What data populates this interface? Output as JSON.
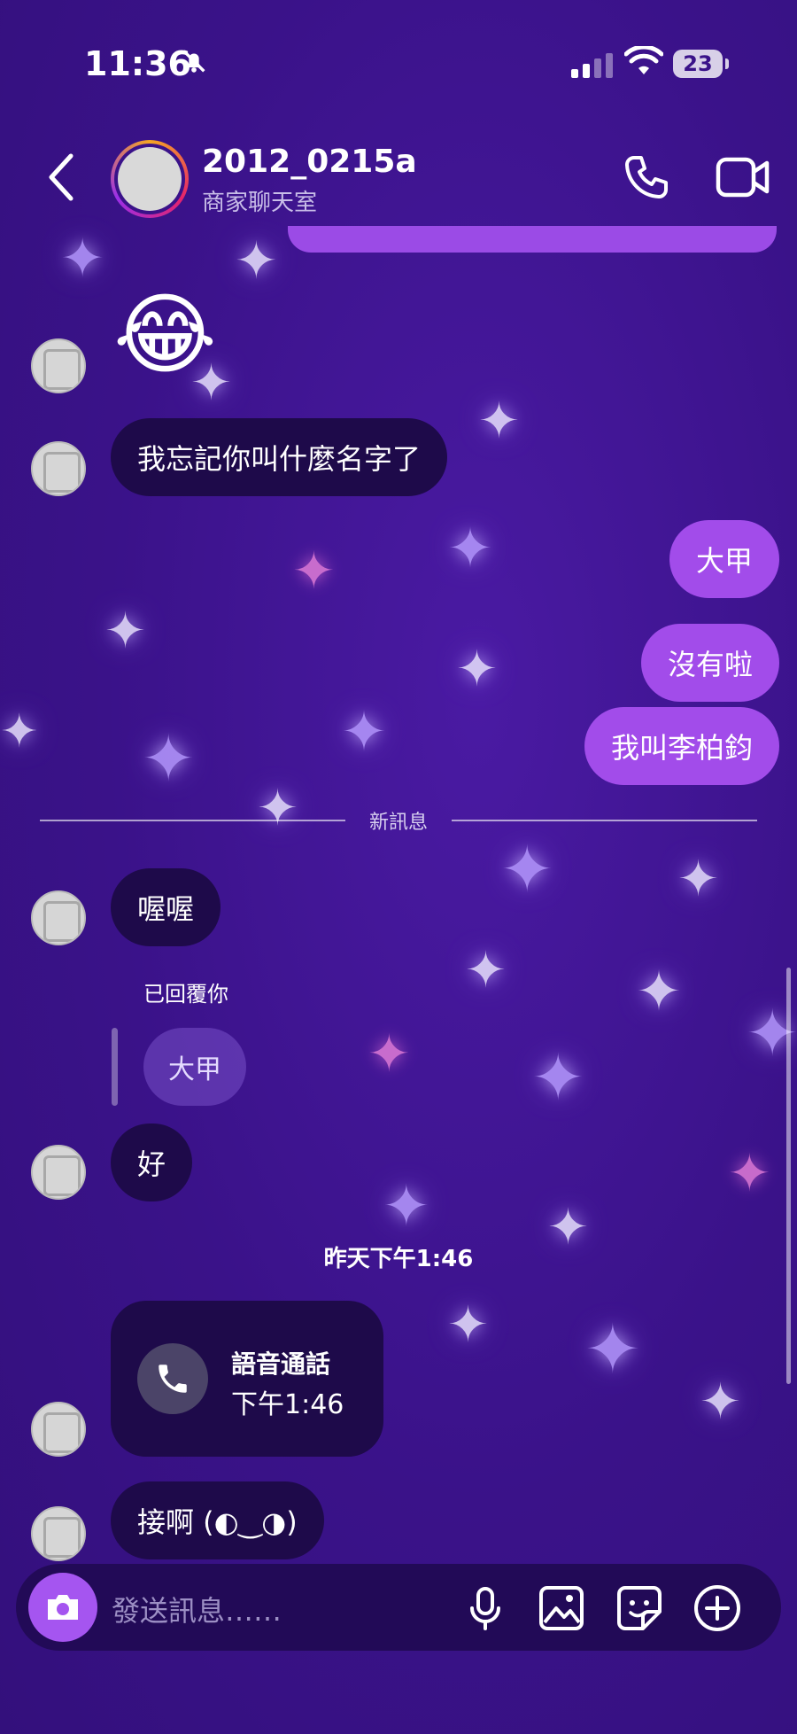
{
  "status_bar": {
    "time": "11:36",
    "battery": "23"
  },
  "header": {
    "title": "2012_0215a",
    "subtitle": "商家聊天室"
  },
  "messages": {
    "msg1": "我忘記你叫什麼名字了",
    "out1": "大甲",
    "out2": "沒有啦",
    "out3": "我叫李柏鈞",
    "new_divider": "新訊息",
    "msg2": "喔喔",
    "replied_label": "已回覆你",
    "reply_quote": "大甲",
    "msg3": "好",
    "timestamp": "昨天下午1:46",
    "call_title": "語音通話",
    "call_time": "下午1:46",
    "msg4": "接啊 (◐‿◑)"
  },
  "composer": {
    "placeholder": "發送訊息……"
  },
  "colors": {
    "background": "#3a1289",
    "outgoing": "#a24cea",
    "incoming": "#1e0a4a",
    "camera_button": "#a555f0"
  },
  "icons": [
    "back-icon",
    "phone-icon",
    "video-icon",
    "camera-icon",
    "microphone-icon",
    "image-icon",
    "sticker-icon",
    "plus-icon",
    "muted-bell-icon",
    "signal-icon",
    "wifi-icon"
  ]
}
